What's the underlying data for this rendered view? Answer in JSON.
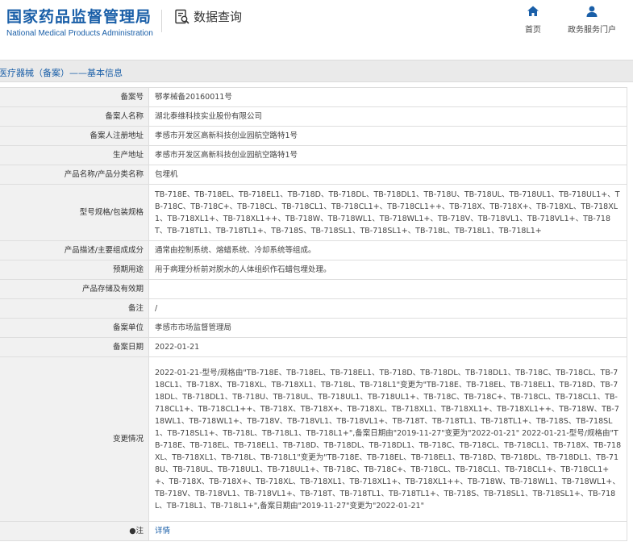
{
  "header": {
    "logo_cn": "国家药品监督管理局",
    "logo_en": "National Medical Products Administration",
    "query_title": "数据查询",
    "nav": {
      "home": "首页",
      "portal": "政务服务门户"
    }
  },
  "breadcrumb": "医疗器械（备案）——基本信息",
  "fields": [
    {
      "label": "备案号",
      "value": "鄂孝械备20160011号"
    },
    {
      "label": "备案人名称",
      "value": "湖北泰维科技实业股份有限公司"
    },
    {
      "label": "备案人注册地址",
      "value": "孝感市开发区高新科技创业园航空路特1号"
    },
    {
      "label": "生产地址",
      "value": "孝感市开发区高新科技创业园航空路特1号"
    },
    {
      "label": "产品名称/产品分类名称",
      "value": "包埋机"
    },
    {
      "label": "型号规格/包装规格",
      "value": "TB-718E、TB-718EL、TB-718EL1、TB-718D、TB-718DL、TB-718DL1、TB-718U、TB-718UL、TB-718UL1、TB-718UL1+、TB-718C、TB-718C+、TB-718CL、TB-718CL1、TB-718CL1+、TB-718CL1++、TB-718X、TB-718X+、TB-718XL、TB-718XL1、TB-718XL1+、TB-718XL1++、TB-718W、TB-718WL1、TB-718WL1+、TB-718V、TB-718VL1、TB-718VL1+、TB-718T、TB-718TL1、TB-718TL1+、TB-718S、TB-718SL1、TB-718SL1+、TB-718L、TB-718L1、TB-718L1+"
    },
    {
      "label": "产品描述/主要组成成分",
      "value": "通常由控制系统、熔蜡系统、冷却系统等组成。"
    },
    {
      "label": "预期用途",
      "value": "用于病理分析前对脱水的人体组织作石蜡包埋处理。"
    },
    {
      "label": "产品存储及有效期",
      "value": ""
    },
    {
      "label": "备注",
      "value": "/"
    },
    {
      "label": "备案单位",
      "value": "孝感市市场监督管理局"
    },
    {
      "label": "备案日期",
      "value": "2022-01-21"
    },
    {
      "label": "变更情况",
      "value": "2022-01-21-型号/规格由\"TB-718E、TB-718EL、TB-718EL1、TB-718D、TB-718DL、TB-718DL1、TB-718C、TB-718CL、TB-718CL1、TB-718X、TB-718XL、TB-718XL1、TB-718L、TB-718L1\"变更为\"TB-718E、TB-718EL、TB-718EL1、TB-718D、TB-718DL、TB-718DL1、TB-718U、TB-718UL、TB-718UL1、TB-718UL1+、TB-718C、TB-718C+、TB-718CL、TB-718CL1、TB-718CL1+、TB-718CL1++、TB-718X、TB-718X+、TB-718XL、TB-718XL1、TB-718XL1+、TB-718XL1++、TB-718W、TB-718WL1、TB-718WL1+、TB-718V、TB-718VL1、TB-718VL1+、TB-718T、TB-718TL1、TB-718TL1+、TB-718S、TB-718SL1、TB-718SL1+、TB-718L、TB-718L1、TB-718L1+\",备案日期由\"2019-11-27\"变更为\"2022-01-21\" 2022-01-21-型号/规格由\"TB-718E、TB-718EL、TB-718EL1、TB-718D、TB-718DL、TB-718DL1、TB-718C、TB-718CL、TB-718CL1、TB-718X、TB-718XL、TB-718XL1、TB-718L、TB-718L1\"变更为\"TB-718E、TB-718EL、TB-718EL1、TB-718D、TB-718DL、TB-718DL1、TB-718U、TB-718UL、TB-718UL1、TB-718UL1+、TB-718C、TB-718C+、TB-718CL、TB-718CL1、TB-718CL1+、TB-718CL1++、TB-718X、TB-718X+、TB-718XL、TB-718XL1、TB-718XL1+、TB-718XL1++、TB-718W、TB-718WL1、TB-718WL1+、TB-718V、TB-718VL1、TB-718VL1+、TB-718T、TB-718TL1、TB-718TL1+、TB-718S、TB-718SL1、TB-718SL1+、TB-718L、TB-718L1、TB-718L1+\",备案日期由\"2019-11-27\"变更为\"2022-01-21\""
    },
    {
      "label": "●注",
      "value": "详情"
    }
  ],
  "colors": {
    "brand": "#1a5fa8",
    "label_bg": "#f1f1f1",
    "border": "#dedede",
    "crumb_bg": "#eaeaea"
  },
  "icons": {
    "query": "document-search-icon",
    "home": "home-icon",
    "portal": "user-icon"
  }
}
